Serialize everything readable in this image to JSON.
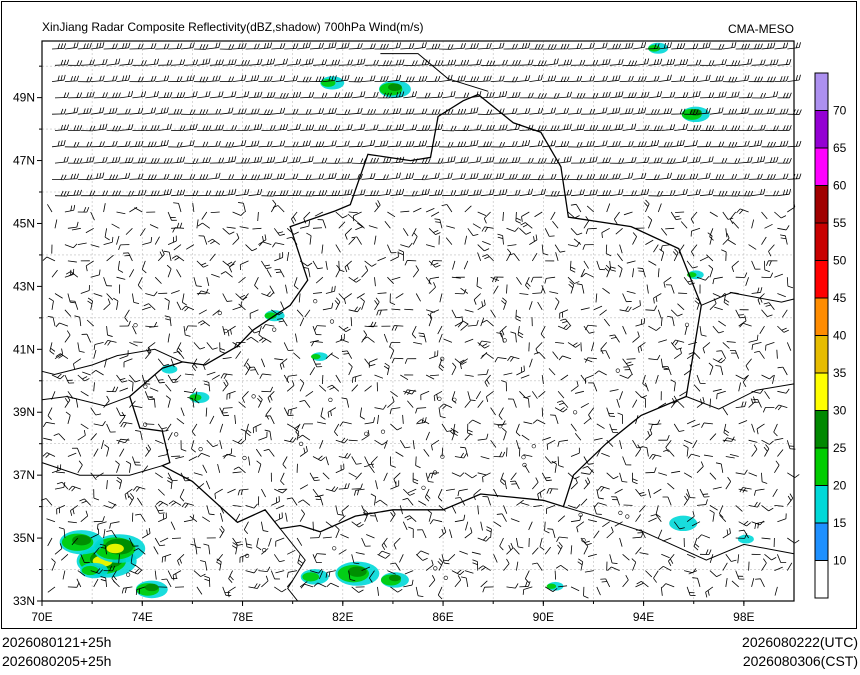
{
  "header": {
    "title": "XinJiang Radar Composite Reflectivity(dBZ,shadow) 700hPa Wind(m/s)",
    "source": "CMA-MESO"
  },
  "footer": {
    "left_line1": "2026080121+25h",
    "left_line2": "2026080205+25h",
    "right_line1": "2026080222(UTC)",
    "right_line2": "2026080306(CST)"
  },
  "map": {
    "lat_labels": [
      "49N",
      "47N",
      "45N",
      "43N",
      "41N",
      "39N",
      "37N",
      "35N",
      "33N"
    ],
    "lon_labels": [
      "70E",
      "74E",
      "78E",
      "82E",
      "86E",
      "90E",
      "94E",
      "98E"
    ],
    "lon_range": [
      70,
      100
    ],
    "lat_range": [
      33,
      50.8
    ]
  },
  "colorbar": {
    "labels": [
      "10",
      "15",
      "20",
      "25",
      "30",
      "35",
      "40",
      "45",
      "50",
      "55",
      "60",
      "65",
      "70"
    ],
    "colors": [
      "#ffffff",
      "#1e90ff",
      "#00d8d8",
      "#00cc00",
      "#008800",
      "#ffff00",
      "#e6bc00",
      "#ff8c00",
      "#ff0000",
      "#c80000",
      "#a00000",
      "#ff00ff",
      "#9400d3",
      "#ad90f0"
    ]
  }
}
